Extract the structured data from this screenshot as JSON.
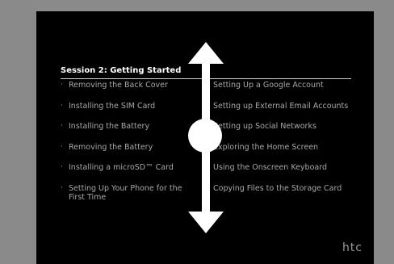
{
  "slide": {
    "title": "Session 2: Getting Started",
    "left_items": [
      "Removing the Back Cover",
      "Installing the SIM Card",
      "Installing the Battery",
      "Removing the Battery",
      "Installing a microSD™ Card",
      "Setting Up Your Phone for the First Time"
    ],
    "right_items": [
      "Setting Up a Google Account",
      "Setting up External Email Accounts",
      "Setting up Social Networks",
      "Exploring the Home Screen",
      "Using the Onscreen Keyboard",
      "Copying Files to the Storage Card"
    ],
    "logo": "htc",
    "bullet_char": "·"
  },
  "gesture": {
    "icon": "vertical-scroll-arrows-icon"
  },
  "colors": {
    "frame": "#8a8a8a",
    "slide_bg": "#000000",
    "bullet": "#e0a020",
    "text": "#a8a8a8",
    "title": "#ffffff",
    "gesture": "#ffffff"
  }
}
